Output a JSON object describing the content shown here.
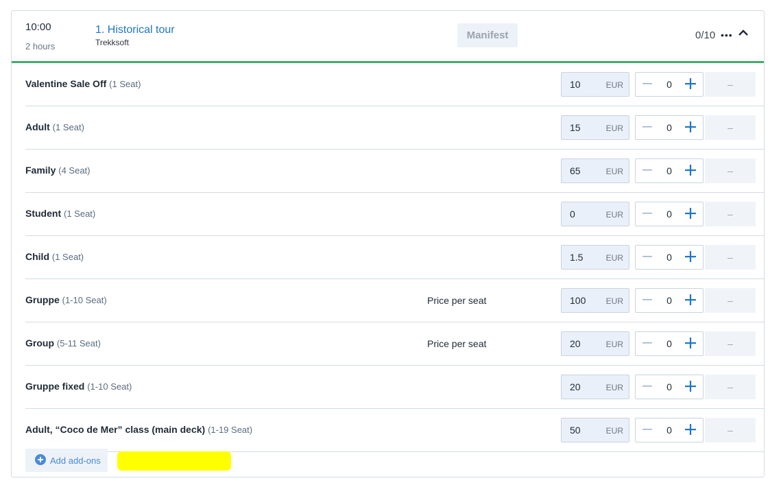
{
  "header": {
    "time": "10:00",
    "duration": "2 hours",
    "tour_title": "1. Historical tour",
    "tour_subtitle": "Trekksoft",
    "manifest_label": "Manifest",
    "capacity": "0/10",
    "more_glyph": "•••"
  },
  "currency": "EUR",
  "rows": [
    {
      "name": "Valentine Sale Off",
      "seat": "(1 Seat)",
      "note": "",
      "price": "10",
      "qty": "0",
      "total": "–"
    },
    {
      "name": "Adult",
      "seat": "(1 Seat)",
      "note": "",
      "price": "15",
      "qty": "0",
      "total": "–"
    },
    {
      "name": "Family",
      "seat": "(4 Seat)",
      "note": "",
      "price": "65",
      "qty": "0",
      "total": "–"
    },
    {
      "name": "Student",
      "seat": "(1 Seat)",
      "note": "",
      "price": "0",
      "qty": "0",
      "total": "–"
    },
    {
      "name": "Child",
      "seat": "(1 Seat)",
      "note": "",
      "price": "1.5",
      "qty": "0",
      "total": "–"
    },
    {
      "name": "Gruppe",
      "seat": "(1-10 Seat)",
      "note": "Price per seat",
      "price": "100",
      "qty": "0",
      "total": "–"
    },
    {
      "name": "Group",
      "seat": "(5-11 Seat)",
      "note": "Price per seat",
      "price": "20",
      "qty": "0",
      "total": "–"
    },
    {
      "name": "Gruppe fixed",
      "seat": "(1-10 Seat)",
      "note": "",
      "price": "20",
      "qty": "0",
      "total": "–"
    },
    {
      "name": "Adult, “Coco de Mer” class (main deck)",
      "seat": "(1-19 Seat)",
      "note": "",
      "price": "50",
      "qty": "0",
      "total": "–"
    }
  ],
  "addons": {
    "label": "Add add-ons"
  },
  "colors": {
    "accent": "#1f76c5",
    "progress": "#3fae6a",
    "highlight": "#ffff00"
  }
}
